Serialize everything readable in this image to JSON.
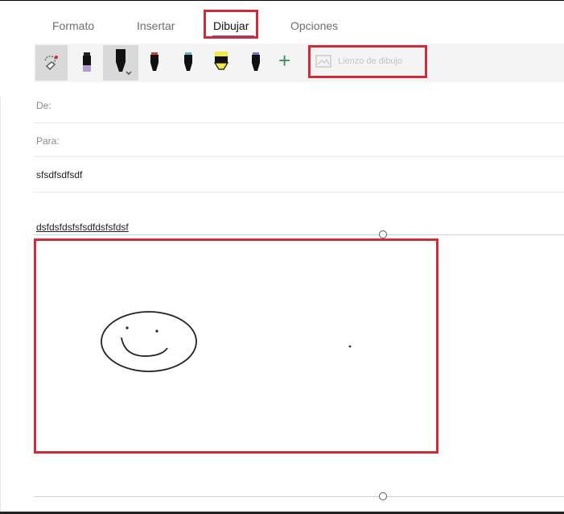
{
  "tabs": [
    {
      "label": "Formato",
      "active": false
    },
    {
      "label": "Insertar",
      "active": false
    },
    {
      "label": "Dibujar",
      "active": true
    },
    {
      "label": "Opciones",
      "active": false
    }
  ],
  "ribbon": {
    "tools": [
      {
        "name": "lasso-eraser-icon",
        "selected": true
      },
      {
        "name": "highlighter-purple-icon",
        "selected": false
      },
      {
        "name": "pen-black-icon",
        "selected": true
      },
      {
        "name": "pen-red-icon",
        "selected": false
      },
      {
        "name": "pen-teal-icon",
        "selected": false
      },
      {
        "name": "highlighter-yellow-icon",
        "selected": false
      },
      {
        "name": "pen-purple-icon",
        "selected": false
      }
    ],
    "add_label": "+",
    "canvas_button_label": "Lienzo de dibujo"
  },
  "form": {
    "from_label": "De:",
    "to_label": "Para:",
    "subject": "sfsdfsdfsdf",
    "body_line": "dsfdsfdsfsfsdfdsfsfdsf"
  },
  "colors": {
    "highlight_red": "#d12b3a",
    "tab_underline": "#3b6cc8",
    "plus_green": "#3f8d5a"
  }
}
